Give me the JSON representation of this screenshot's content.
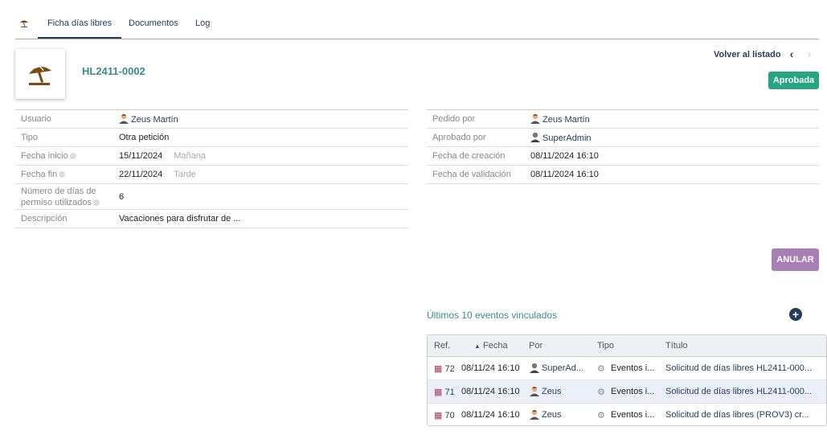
{
  "tabs": {
    "tab_1": "Ficha días libres",
    "tab_2": "Documentos",
    "tab_3": "Log"
  },
  "header": {
    "reference": "HL2411-0002",
    "back_label": "Volver al listado",
    "prev_glyph": "‹",
    "next_glyph": "›",
    "status": "Aprobada"
  },
  "left_fields": {
    "usuario_label": "Usuario",
    "usuario_value": "Zeus Martín",
    "tipo_label": "Tipo",
    "tipo_value": "Otra petición",
    "fecha_inicio_label": "Fecha inicio",
    "fecha_inicio_value": "15/11/2024",
    "fecha_inicio_half": "Mañana",
    "fecha_fin_label": "Fecha fin",
    "fecha_fin_value": "22/11/2024",
    "fecha_fin_half": "Tarde",
    "dias_label_1": "Número de días de",
    "dias_label_2": "permiso utilizados",
    "dias_value": "6",
    "descripcion_label": "Descripción",
    "descripcion_value": "Vacaciones para disfrutar de ..."
  },
  "right_fields": {
    "pedido_label": "Pedido por",
    "pedido_value": "Zeus Martín",
    "aprobado_label": "Aprobado por",
    "aprobado_value": "SuperAdmin",
    "creacion_label": "Fecha de creación",
    "creacion_value": "08/11/2024 16:10",
    "validacion_label": "Fecha de validación",
    "validacion_value": "08/11/2024 16:10"
  },
  "actions": {
    "anular": "ANULAR",
    "add_glyph": "+"
  },
  "events": {
    "title": "Últimos 10 eventos vinculados",
    "columns": {
      "ref": "Ref.",
      "fecha": "Fecha",
      "por": "Por",
      "tipo": "Tipo",
      "titulo": "Título"
    },
    "rows": [
      {
        "ref": "72",
        "fecha": "08/11/24 16:10",
        "por": "SuperAd...",
        "tipo": "Eventos i...",
        "titulo": "Solicitud de días libres HL2411-000..."
      },
      {
        "ref": "71",
        "fecha": "08/11/24 16:10",
        "por": "Zeus",
        "tipo": "Eventos i...",
        "titulo": "Solicitud de días libres HL2411-000..."
      },
      {
        "ref": "70",
        "fecha": "08/11/24 16:10",
        "por": "Zeus",
        "tipo": "Eventos i...",
        "titulo": "Solicitud de días libres (PROV3) cr..."
      }
    ]
  },
  "icons": {
    "tab_icon": "beach-umbrella-icon",
    "logo": "beach-umbrella-icon",
    "avatar": "user-avatar-icon",
    "calendar": "calendar-icon",
    "gear": "gear-icon",
    "sort": "sort-asc-icon"
  },
  "colors": {
    "primary": "#263c5c",
    "ref_title": "#3d8a8a",
    "approved": "#25a580",
    "anular": "#a77fb5",
    "umbrella": "#7a4a10"
  }
}
